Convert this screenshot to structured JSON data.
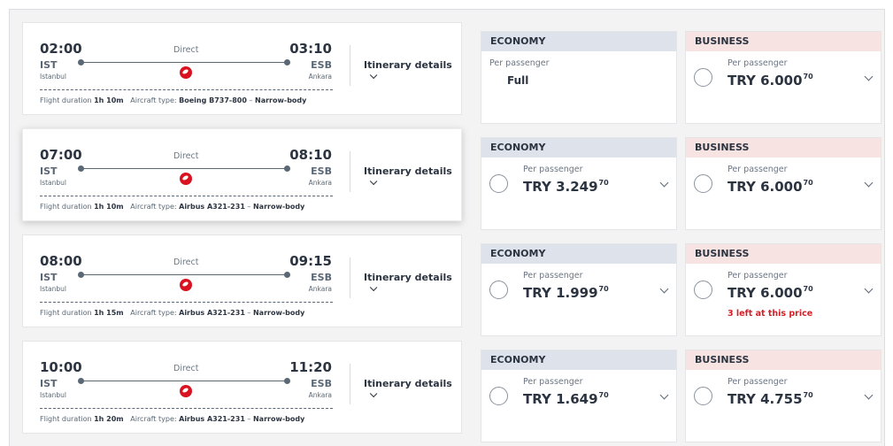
{
  "flights": [
    {
      "dep_time": "02:00",
      "dep_code": "IST",
      "dep_city": "Istanbul",
      "arr_time": "03:10",
      "arr_code": "ESB",
      "arr_city": "Ankara",
      "stops": "Direct",
      "duration_label": "Flight duration",
      "duration": "1h 10m",
      "aircraft_label": "Aircraft type:",
      "aircraft": "Boeing B737-800",
      "body": "Narrow-body",
      "itinerary": "Itinerary details",
      "economy": {
        "header": "ECONOMY",
        "per_passenger": "Per passenger",
        "status": "Full"
      },
      "business": {
        "header": "BUSINESS",
        "per_passenger": "Per passenger",
        "currency": "TRY",
        "amount": "6.000",
        "cents": "70"
      }
    },
    {
      "dep_time": "07:00",
      "dep_code": "IST",
      "dep_city": "Istanbul",
      "arr_time": "08:10",
      "arr_code": "ESB",
      "arr_city": "Ankara",
      "stops": "Direct",
      "duration_label": "Flight duration",
      "duration": "1h 10m",
      "aircraft_label": "Aircraft type:",
      "aircraft": "Airbus A321-231",
      "body": "Narrow-body",
      "itinerary": "Itinerary details",
      "economy": {
        "header": "ECONOMY",
        "per_passenger": "Per passenger",
        "currency": "TRY",
        "amount": "3.249",
        "cents": "70"
      },
      "business": {
        "header": "BUSINESS",
        "per_passenger": "Per passenger",
        "currency": "TRY",
        "amount": "6.000",
        "cents": "70"
      }
    },
    {
      "dep_time": "08:00",
      "dep_code": "IST",
      "dep_city": "Istanbul",
      "arr_time": "09:15",
      "arr_code": "ESB",
      "arr_city": "Ankara",
      "stops": "Direct",
      "duration_label": "Flight duration",
      "duration": "1h 15m",
      "aircraft_label": "Aircraft type:",
      "aircraft": "Airbus A321-231",
      "body": "Narrow-body",
      "itinerary": "Itinerary details",
      "economy": {
        "header": "ECONOMY",
        "per_passenger": "Per passenger",
        "currency": "TRY",
        "amount": "1.999",
        "cents": "70"
      },
      "business": {
        "header": "BUSINESS",
        "per_passenger": "Per passenger",
        "currency": "TRY",
        "amount": "6.000",
        "cents": "70",
        "warning": "3 left at this price"
      }
    },
    {
      "dep_time": "10:00",
      "dep_code": "IST",
      "dep_city": "Istanbul",
      "arr_time": "11:20",
      "arr_code": "ESB",
      "arr_city": "Ankara",
      "stops": "Direct",
      "duration_label": "Flight duration",
      "duration": "1h 20m",
      "aircraft_label": "Aircraft type:",
      "aircraft": "Airbus A321-231",
      "body": "Narrow-body",
      "itinerary": "Itinerary details",
      "economy": {
        "header": "ECONOMY",
        "per_passenger": "Per passenger",
        "currency": "TRY",
        "amount": "1.649",
        "cents": "70"
      },
      "business": {
        "header": "BUSINESS",
        "per_passenger": "Per passenger",
        "currency": "TRY",
        "amount": "4.755",
        "cents": "70"
      }
    }
  ],
  "airline_logo_icon": "turkish-airlines-logo-icon",
  "colors": {
    "economy_header": "#dee2ea",
    "business_header": "#f7e4e2",
    "warning": "#d31f26",
    "airline_red": "#d9121f"
  }
}
